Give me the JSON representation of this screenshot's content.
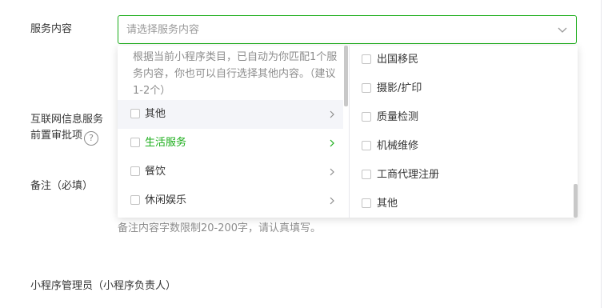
{
  "form": {
    "service_label": "服务内容",
    "icp_label_line1": "互联网信息服务",
    "icp_label_line2": "前置审批项",
    "help_glyph": "?",
    "remark_label": "备注（必填）",
    "remark_hint": "备注内容字数限制20-200字，请认真填写。",
    "manager_label": "小程序管理员（小程序负责人）"
  },
  "select": {
    "placeholder": "请选择服务内容",
    "chevron_icon": "chevron-down-icon"
  },
  "dropdown": {
    "note": "根据当前小程序类目，已自动为你匹配1个服务内容，你也可以自行选择其他内容。（建议1-2个）",
    "categories": [
      {
        "label": "其他",
        "state": "hover"
      },
      {
        "label": "生活服务",
        "state": "active"
      },
      {
        "label": "餐饮",
        "state": "normal"
      },
      {
        "label": "休闲娱乐",
        "state": "normal"
      }
    ],
    "subitems": [
      {
        "label": "出国移民"
      },
      {
        "label": "摄影/扩印"
      },
      {
        "label": "质量检测"
      },
      {
        "label": "机械维修"
      },
      {
        "label": "工商代理注册"
      },
      {
        "label": "其他"
      }
    ]
  },
  "colors": {
    "accent_green": "#1aad19",
    "text": "#353535",
    "muted": "#8d8d8d"
  }
}
